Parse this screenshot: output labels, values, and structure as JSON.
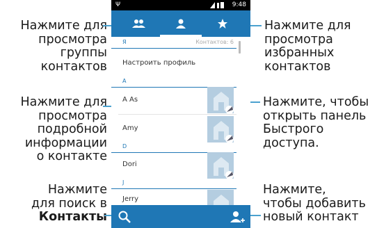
{
  "callouts": {
    "groups": [
      "Нажмите для",
      "просмотра",
      "группы",
      "контактов"
    ],
    "favorites": [
      "Нажмите для",
      "просмотра",
      "избранных",
      "контактов"
    ],
    "details": [
      "Нажмите для",
      "просмотра",
      "подробной",
      "информации",
      "о контакте"
    ],
    "quick_panel": [
      "Нажмите, чтобы",
      "открыть панель",
      "Быстрого",
      "доступа."
    ],
    "search": [
      "Нажмите",
      "для поиск в",
      "Контакты"
    ],
    "add_contact": [
      "Нажмите,",
      "чтобы добавить",
      "новый контакт"
    ]
  },
  "phone": {
    "status_time": "9:48",
    "list": {
      "me_header": "Я",
      "me_count": "Контактов: 6",
      "setup_profile": "Настроить профиль",
      "sections": [
        {
          "letter": "A",
          "contacts": [
            "A As",
            "Amy"
          ]
        },
        {
          "letter": "D",
          "contacts": [
            "Dori"
          ]
        },
        {
          "letter": "J",
          "contacts": [
            "Jerry"
          ]
        }
      ]
    }
  },
  "colors": {
    "accent": "#1f77b5",
    "leader": "#4aa1cf"
  },
  "icons": {
    "tabs": [
      "groups-icon",
      "contacts-icon",
      "star-icon"
    ],
    "bottom": [
      "search-icon",
      "add-contact-icon"
    ]
  }
}
